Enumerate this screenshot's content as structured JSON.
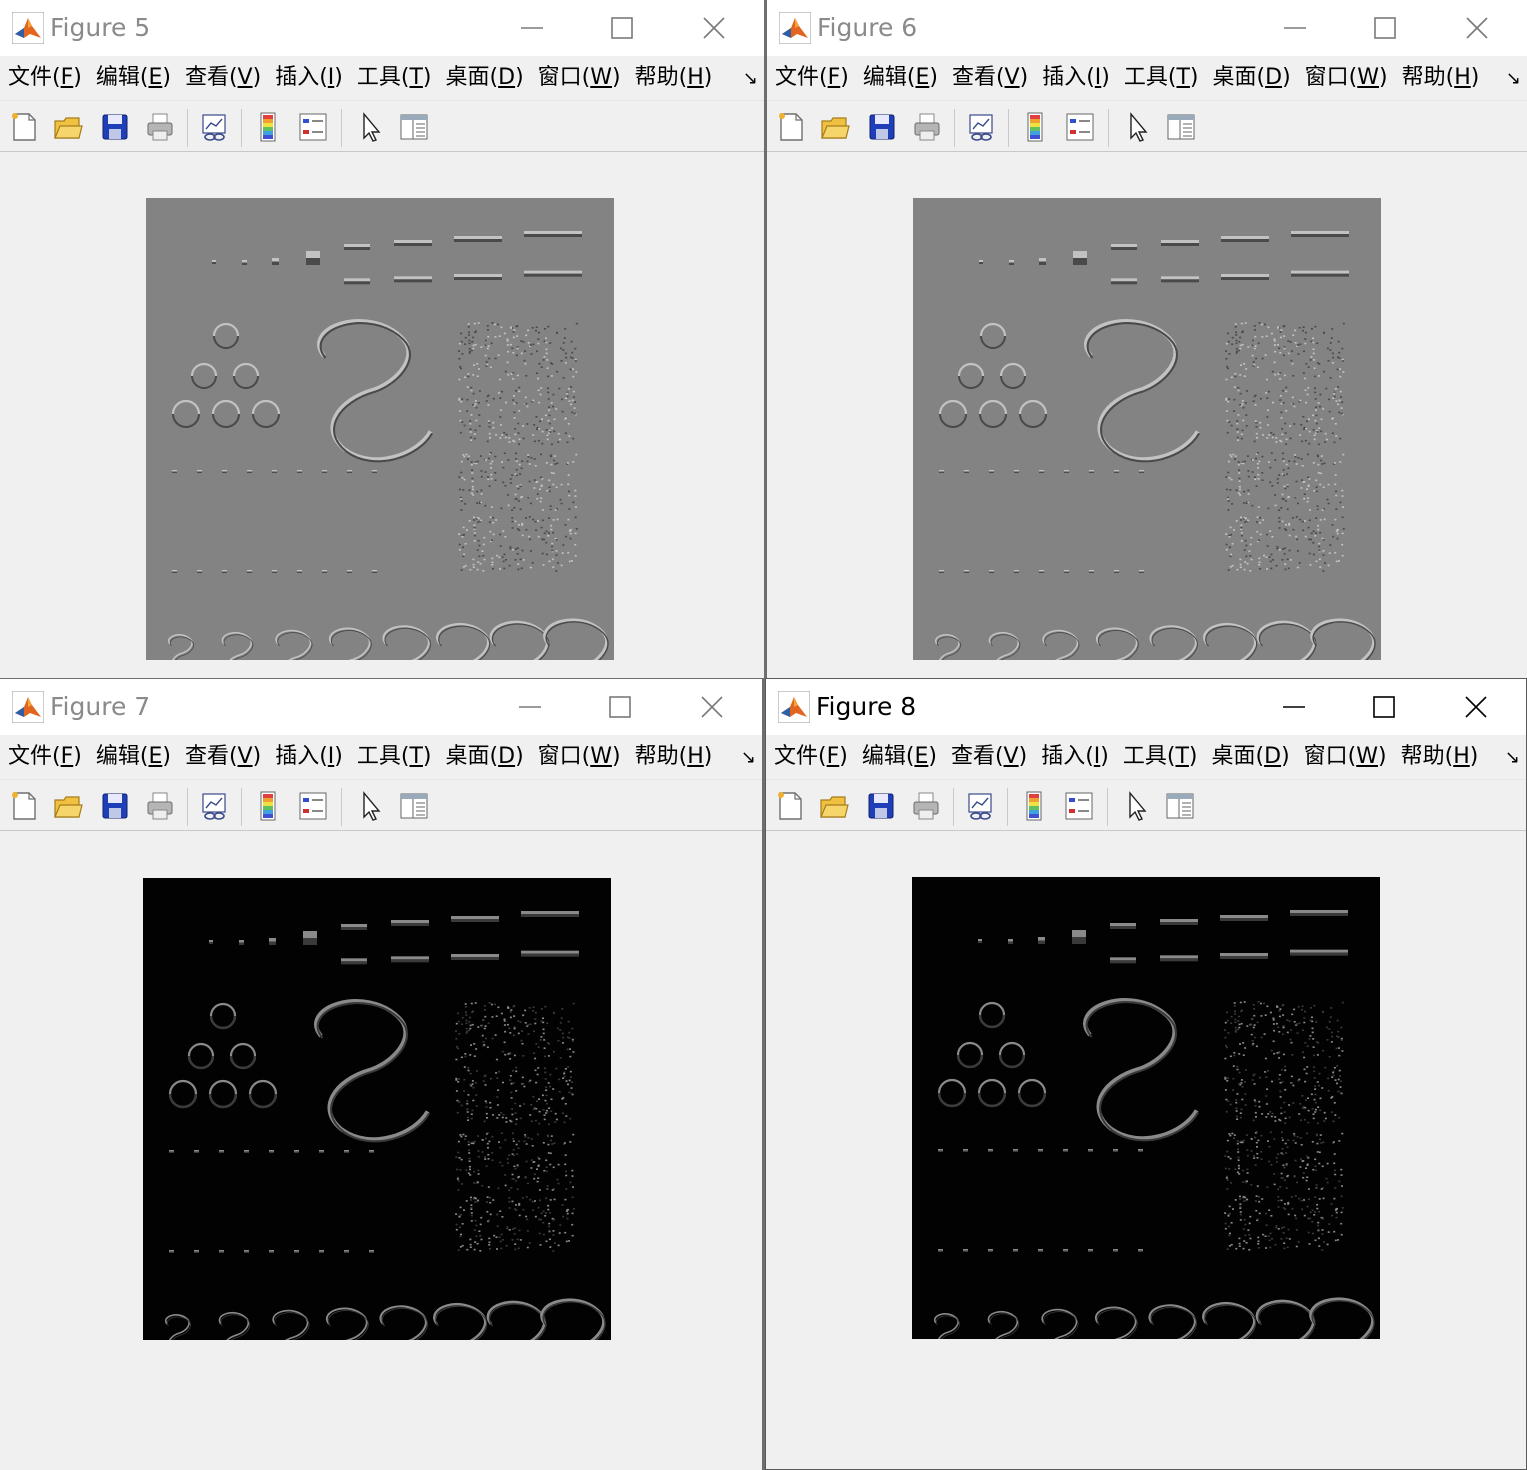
{
  "windows": [
    {
      "id": "w5",
      "title": "Figure 5",
      "style": "emboss"
    },
    {
      "id": "w6",
      "title": "Figure 6",
      "style": "emboss"
    },
    {
      "id": "w7",
      "title": "Figure 7",
      "style": "edge"
    },
    {
      "id": "w8",
      "title": "Figure 8",
      "style": "edge"
    }
  ],
  "menu": [
    {
      "label": "文件(",
      "key": "F",
      "close": ")"
    },
    {
      "label": "编辑(",
      "key": "E",
      "close": ")"
    },
    {
      "label": "查看(",
      "key": "V",
      "close": ")"
    },
    {
      "label": "插入(",
      "key": "I",
      "close": ")"
    },
    {
      "label": "工具(",
      "key": "T",
      "close": ")"
    },
    {
      "label": "桌面(",
      "key": "D",
      "close": ")"
    },
    {
      "label": "窗口(",
      "key": "W",
      "close": ")"
    },
    {
      "label": "帮助(",
      "key": "H",
      "close": ")"
    }
  ],
  "toolbar_icons": [
    "new-figure-icon",
    "open-file-icon",
    "save-icon",
    "print-icon",
    "link-plot-icon",
    "colorbar-icon",
    "legend-icon",
    "pointer-icon",
    "property-inspector-icon"
  ],
  "colors": {
    "emboss_bg": "#838383",
    "edge_bg": "#020202",
    "window_bg": "#f0f0f0",
    "matlab_orange": "#e2641f",
    "matlab_blue": "#2d5fa8"
  }
}
